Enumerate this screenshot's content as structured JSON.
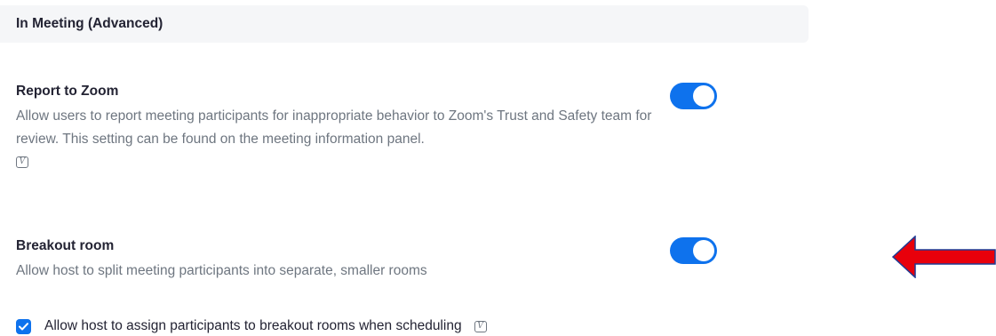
{
  "section": {
    "title": "In Meeting (Advanced)"
  },
  "settings": [
    {
      "title": "Report to Zoom",
      "description": "Allow users to report meeting participants for inappropriate behavior to Zoom's Trust and Safety team for review. This setting can be found on the meeting information panel.",
      "badge": "V",
      "enabled": true
    },
    {
      "title": "Breakout room",
      "description": "Allow host to split meeting participants into separate, smaller rooms",
      "enabled": true,
      "option": {
        "label": "Allow host to assign participants to breakout rooms when scheduling",
        "badge": "V",
        "checked": true
      }
    }
  ],
  "colors": {
    "accent": "#0e72ed",
    "annotation_arrow": "#e8000b",
    "annotation_arrow_outline": "#1f3a93"
  },
  "icons": {
    "version_badge": "v-badge-icon",
    "checkmark": "checkmark-icon",
    "annotation": "left-arrow-icon"
  }
}
